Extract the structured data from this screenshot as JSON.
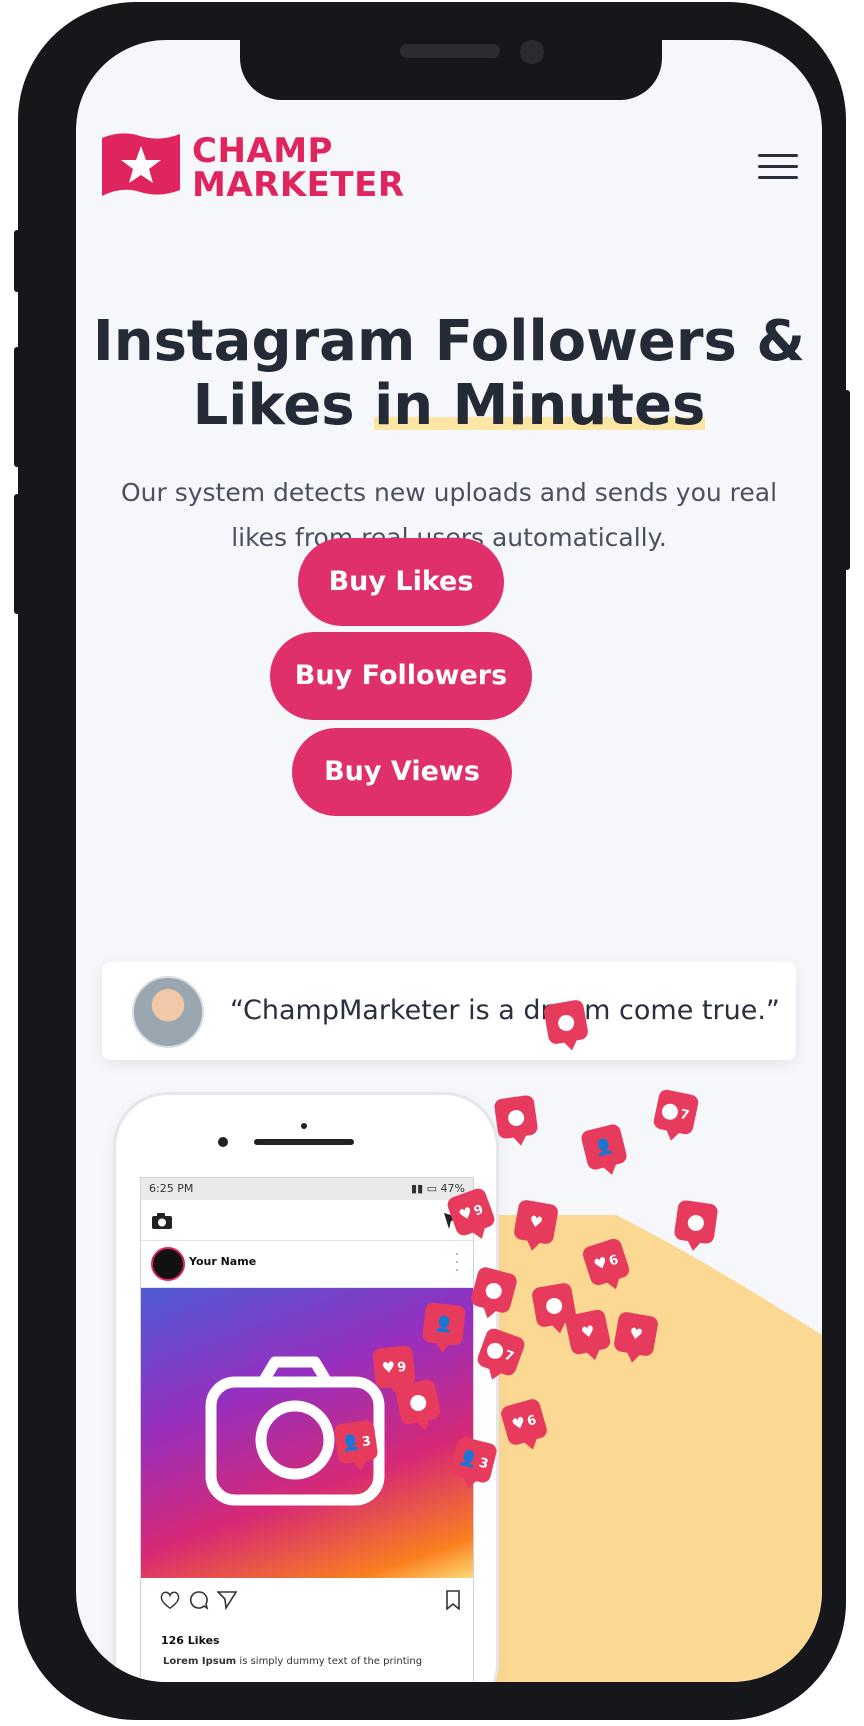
{
  "brand": {
    "line1": "CHAMP",
    "line2": "MARKETER",
    "color": "#e0245e"
  },
  "nav": {
    "menu_icon": "hamburger-icon"
  },
  "hero": {
    "headline_1": "Instagram Followers &",
    "headline_2a": "Likes ",
    "headline_2b": "in Minutes",
    "subtitle": "Our system detects new uploads and sends you real likes from real users automatically."
  },
  "buttons": {
    "likes": "Buy Likes",
    "followers": "Buy Followers",
    "views": "Buy Views",
    "color": "#e0306a"
  },
  "testimonial": {
    "quote": "“ChampMarketer is a dream come true.”"
  },
  "mockup": {
    "time": "6:25 PM",
    "battery": "47%",
    "user": "Your Name",
    "likes": "126 Likes",
    "caption_user": "Lorem Ipsum",
    "caption_text": " is simply dummy text of the printing"
  },
  "notifications": [
    {
      "icon": "comment",
      "count": ""
    },
    {
      "icon": "comment",
      "count": "7"
    },
    {
      "icon": "comment",
      "count": ""
    },
    {
      "icon": "follower",
      "count": ""
    },
    {
      "icon": "heart",
      "count": "9"
    },
    {
      "icon": "heart",
      "count": ""
    },
    {
      "icon": "heart",
      "count": "6"
    },
    {
      "icon": "comment",
      "count": ""
    },
    {
      "icon": "comment",
      "count": ""
    },
    {
      "icon": "comment",
      "count": ""
    },
    {
      "icon": "follower",
      "count": ""
    },
    {
      "icon": "heart",
      "count": "9"
    },
    {
      "icon": "comment",
      "count": "7"
    },
    {
      "icon": "heart",
      "count": ""
    },
    {
      "icon": "heart",
      "count": ""
    },
    {
      "icon": "comment",
      "count": ""
    },
    {
      "icon": "follower",
      "count": "3"
    },
    {
      "icon": "follower",
      "count": "3"
    },
    {
      "icon": "heart",
      "count": "6"
    }
  ]
}
